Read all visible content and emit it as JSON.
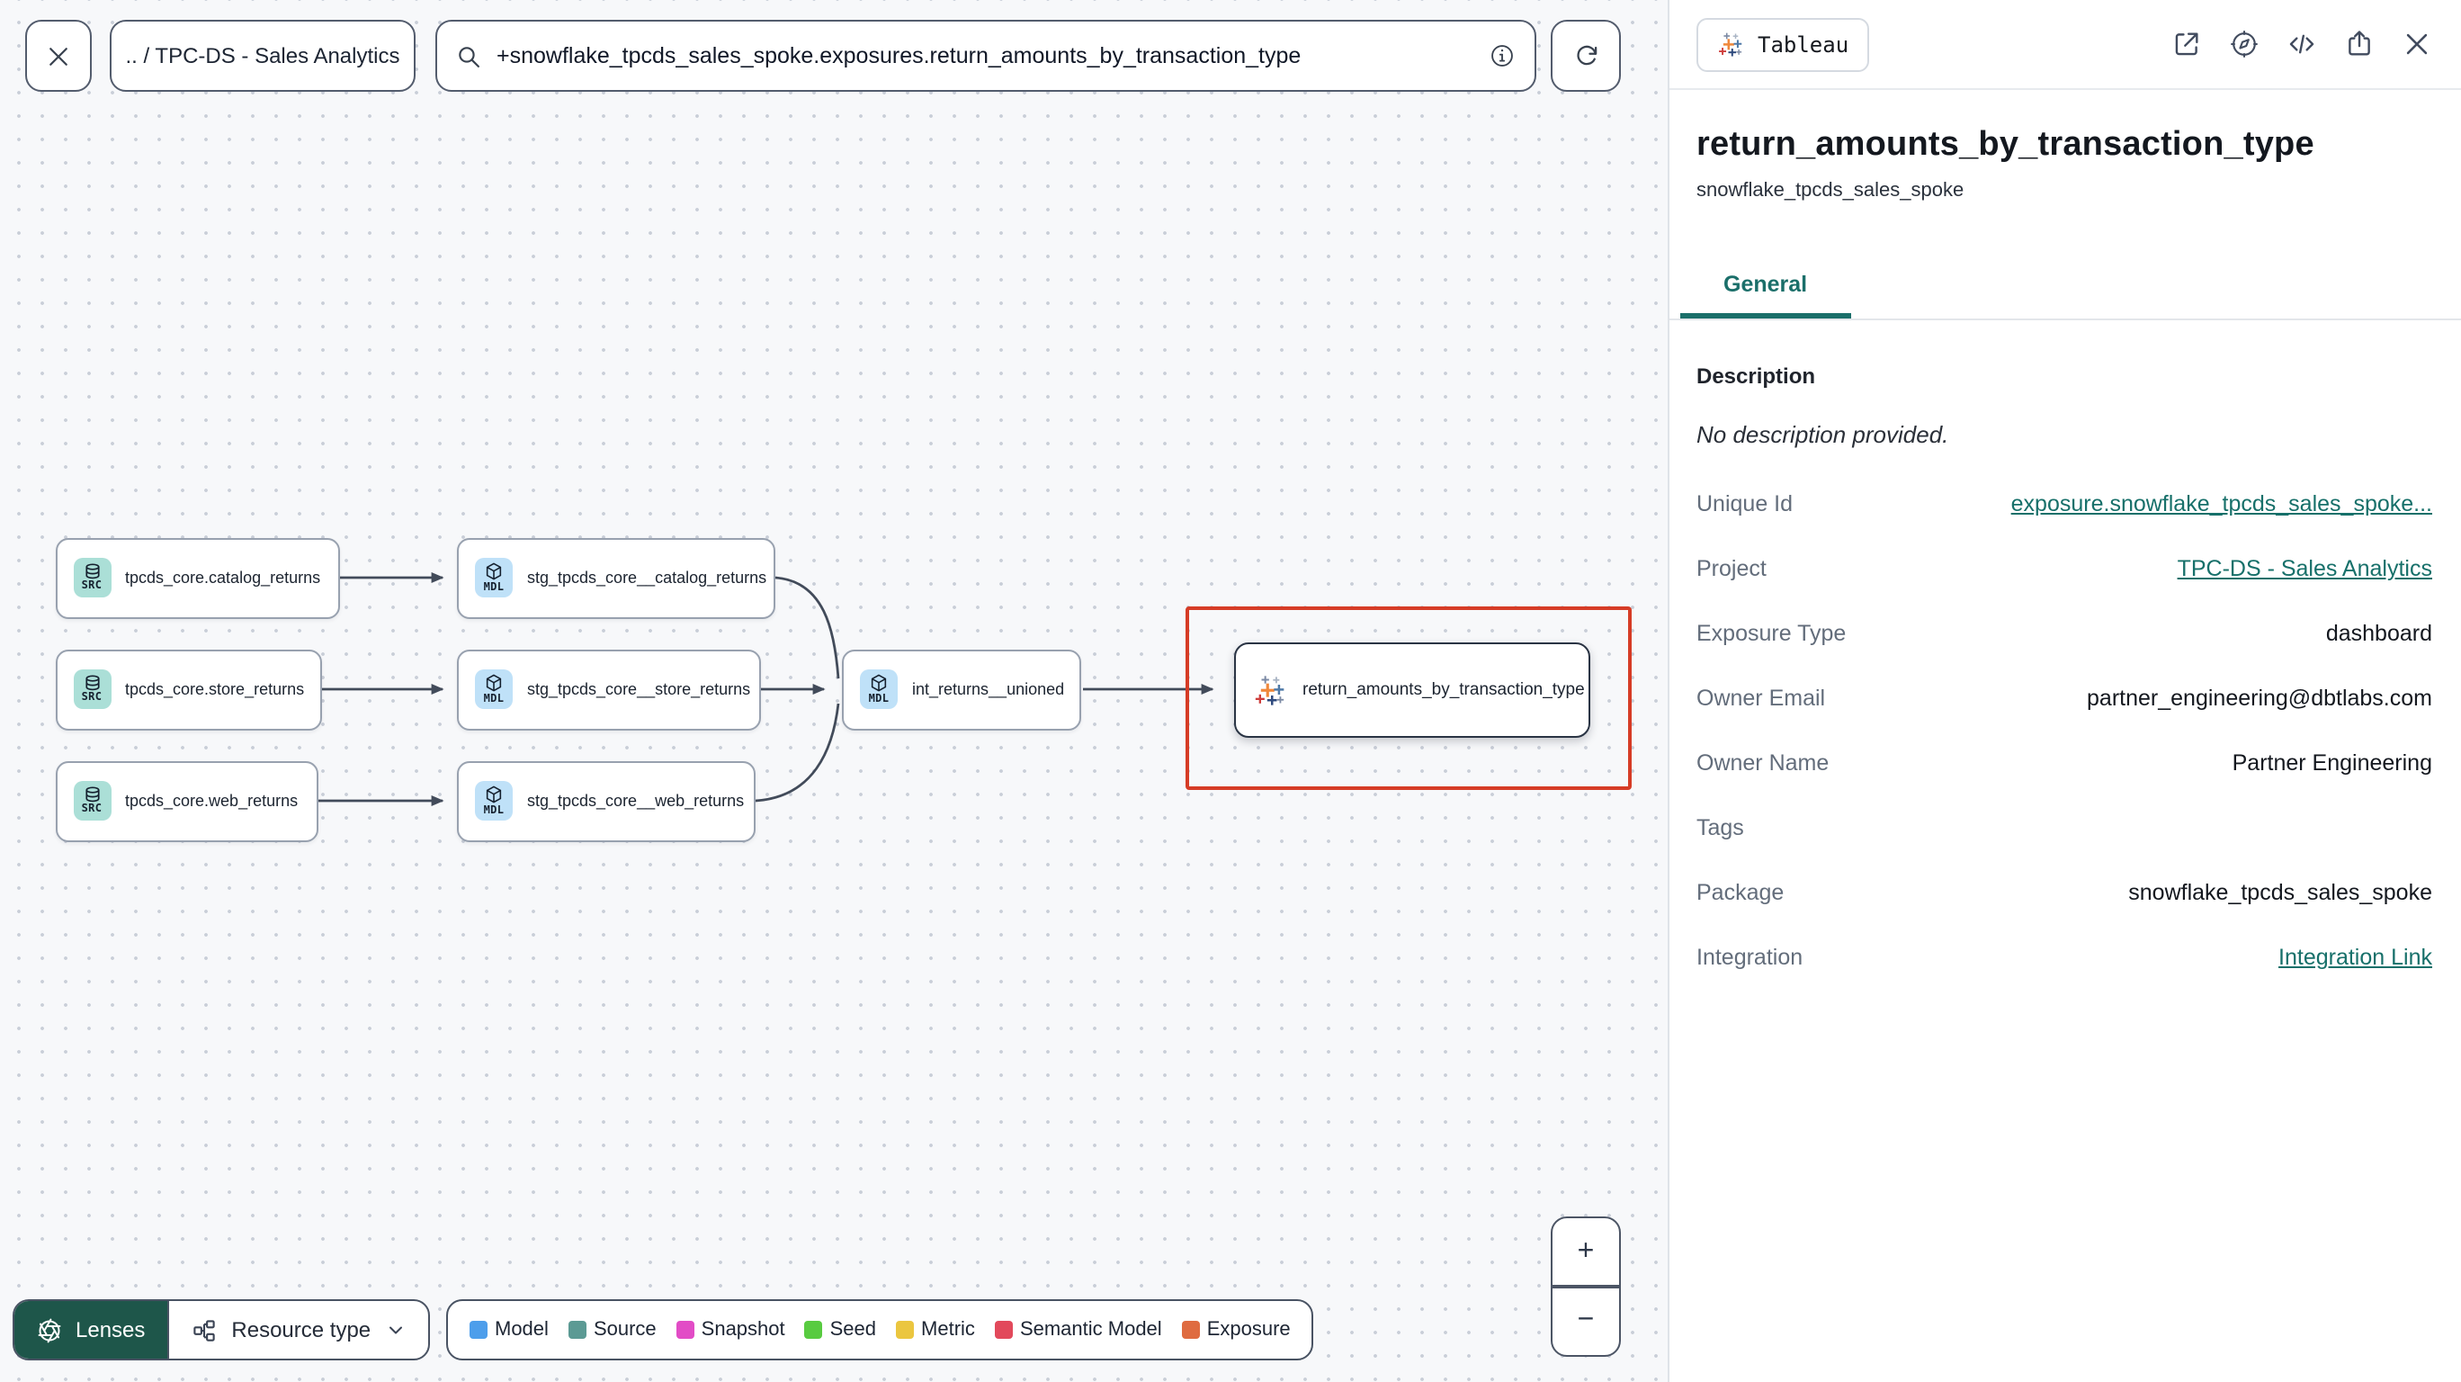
{
  "toolbar": {
    "breadcrumb": ".. / TPC-DS - Sales Analytics",
    "search_value": "+snowflake_tpcds_sales_spoke.exposures.return_amounts_by_transaction_type"
  },
  "graph": {
    "nodes": [
      {
        "badge": "SRC",
        "type": "source",
        "label": "tpcds_core.catalog_returns"
      },
      {
        "badge": "SRC",
        "type": "source",
        "label": "tpcds_core.store_returns"
      },
      {
        "badge": "SRC",
        "type": "source",
        "label": "tpcds_core.web_returns"
      },
      {
        "badge": "MDL",
        "type": "model",
        "label": "stg_tpcds_core__catalog_returns"
      },
      {
        "badge": "MDL",
        "type": "model",
        "label": "stg_tpcds_core__store_returns"
      },
      {
        "badge": "MDL",
        "type": "model",
        "label": "stg_tpcds_core__web_returns"
      },
      {
        "badge": "MDL",
        "type": "model",
        "label": "int_returns__unioned"
      },
      {
        "badge": "tableau-icon",
        "type": "exposure",
        "label": "return_amounts_by_transaction_type"
      }
    ],
    "edges": [
      [
        "tpcds_core.catalog_returns",
        "stg_tpcds_core__catalog_returns"
      ],
      [
        "tpcds_core.store_returns",
        "stg_tpcds_core__store_returns"
      ],
      [
        "tpcds_core.web_returns",
        "stg_tpcds_core__web_returns"
      ],
      [
        "stg_tpcds_core__catalog_returns",
        "int_returns__unioned"
      ],
      [
        "stg_tpcds_core__store_returns",
        "int_returns__unioned"
      ],
      [
        "stg_tpcds_core__web_returns",
        "int_returns__unioned"
      ],
      [
        "int_returns__unioned",
        "return_amounts_by_transaction_type"
      ]
    ],
    "highlight_color": "#d63c26"
  },
  "bottom_bar": {
    "lenses_label": "Lenses",
    "resource_type_label": "Resource type",
    "legend": [
      {
        "label": "Model",
        "color": "#4d9eeb"
      },
      {
        "label": "Source",
        "color": "#5c9a94"
      },
      {
        "label": "Snapshot",
        "color": "#e24cc6"
      },
      {
        "label": "Seed",
        "color": "#58cb40"
      },
      {
        "label": "Metric",
        "color": "#ebc63f"
      },
      {
        "label": "Semantic Model",
        "color": "#e2495b"
      },
      {
        "label": "Exposure",
        "color": "#df6b40"
      }
    ]
  },
  "zoom_controls": {
    "zoom_in": "+",
    "zoom_out": "−"
  },
  "panel": {
    "integration_badge": "Tableau",
    "title": "return_amounts_by_transaction_type",
    "subtitle": "snowflake_tpcds_sales_spoke",
    "tab": "General",
    "description_heading": "Description",
    "description_empty": "No description provided.",
    "details": [
      {
        "label": "Unique Id",
        "value": "exposure.snowflake_tpcds_sales_spoke..."
      },
      {
        "label": "Project",
        "value": "TPC-DS - Sales Analytics"
      },
      {
        "label": "Exposure Type",
        "value": "dashboard"
      },
      {
        "label": "Owner Email",
        "value": "partner_engineering@dbtlabs.com"
      },
      {
        "label": "Owner Name",
        "value": "Partner Engineering"
      },
      {
        "label": "Tags",
        "value": ""
      },
      {
        "label": "Package",
        "value": "snowflake_tpcds_sales_spoke"
      },
      {
        "label": "Integration",
        "value": "Integration Link"
      }
    ],
    "action_icons": [
      "open-in-new",
      "compass",
      "code",
      "share",
      "close"
    ]
  },
  "colors": {
    "accent_teal": "#1b6f6a",
    "lenses_green": "#1e564a",
    "canvas_bg": "#f7f8fa"
  }
}
